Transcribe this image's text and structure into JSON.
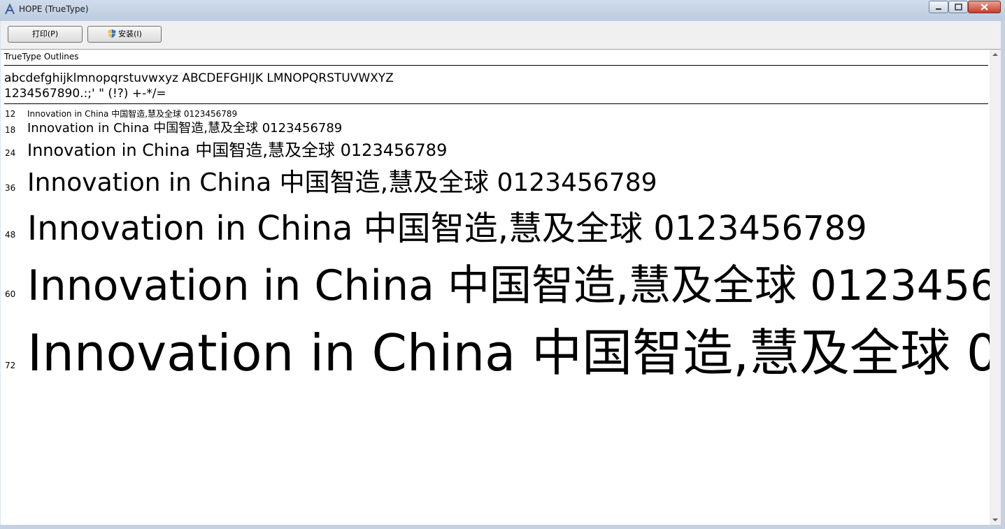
{
  "window": {
    "title": "HOPE (TrueType)"
  },
  "toolbar": {
    "print_label": "打印(P)",
    "install_label": "安装(I)"
  },
  "content": {
    "type_label": "TrueType Outlines",
    "charset_line1": "abcdefghijklmnopqrstuvwxyz ABCDEFGHIJK LMNOPQRSTUVWXYZ",
    "charset_line2": "1234567890.:;' \" (!?) +-*/=",
    "sample_text": "Innovation in China 中国智造,慧及全球 0123456789",
    "sizes": [
      {
        "pt": "12"
      },
      {
        "pt": "18"
      },
      {
        "pt": "24"
      },
      {
        "pt": "36"
      },
      {
        "pt": "48"
      },
      {
        "pt": "60"
      },
      {
        "pt": "72"
      }
    ]
  },
  "icons": {
    "app": "font-icon",
    "install": "uac-shield-icon"
  }
}
